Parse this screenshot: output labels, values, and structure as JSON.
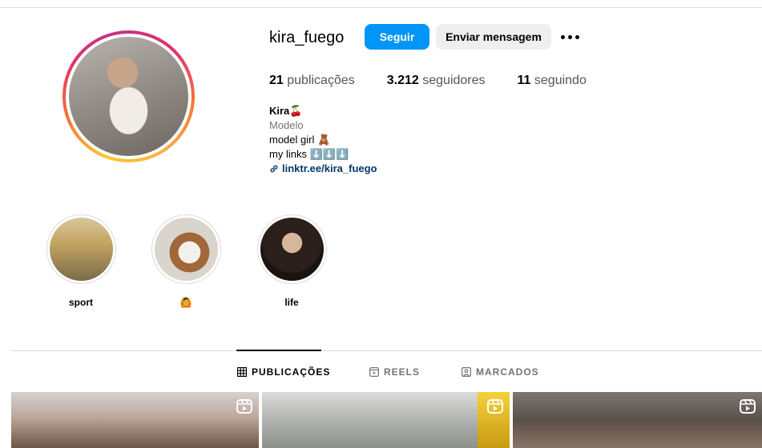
{
  "profile": {
    "username": "kira_fuego",
    "follow_label": "Seguir",
    "message_label": "Enviar mensagem",
    "more_icon": "more-horizontal-icon"
  },
  "stats": [
    {
      "count": "21",
      "label": "publicações"
    },
    {
      "count": "3.212",
      "label": "seguidores"
    },
    {
      "count": "11",
      "label": "seguindo"
    }
  ],
  "bio": {
    "name": "Kira",
    "name_emoji": "🍒",
    "category": "Modelo",
    "line1": "model girl",
    "line1_emoji": "🧸",
    "line2": "my links",
    "line2_emoji": "⬇️⬇️⬇️",
    "link": "linktr.ee/kira_fuego",
    "link_icon": "link-icon"
  },
  "highlights": [
    {
      "label": "sport"
    },
    {
      "label": "🙆"
    },
    {
      "label": "life"
    }
  ],
  "tabs": [
    {
      "label": "PUBLICAÇÕES",
      "icon": "grid-icon",
      "active": true
    },
    {
      "label": "REELS",
      "icon": "reels-icon",
      "active": false
    },
    {
      "label": "MARCADOS",
      "icon": "tagged-icon",
      "active": false
    }
  ],
  "posts": [
    {
      "type": "reel",
      "icon": "reel-icon"
    },
    {
      "type": "reel",
      "icon": "reel-icon"
    },
    {
      "type": "reel",
      "icon": "reel-icon"
    }
  ],
  "colors": {
    "accent": "#0095f6",
    "link": "#00376b",
    "secondary_text": "#737373"
  }
}
